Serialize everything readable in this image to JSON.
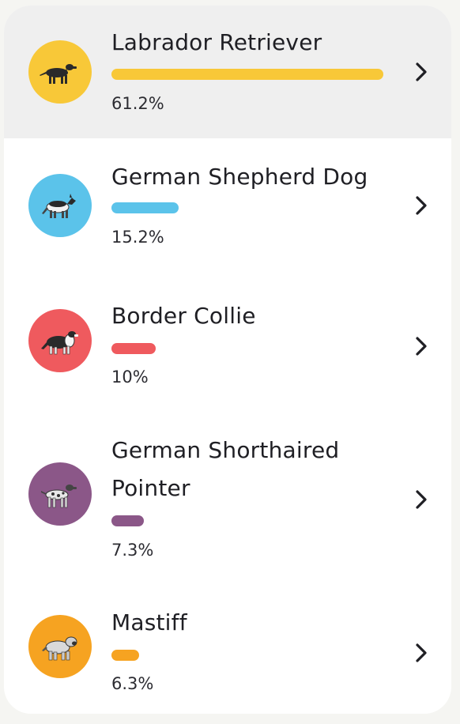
{
  "breeds": [
    {
      "name": "Labrador Retriever",
      "percent_label": "61.2%",
      "share": 61.2,
      "color": "#f8c838",
      "selected": true,
      "icon": "labrador-dog-icon"
    },
    {
      "name": "German Shepherd Dog",
      "percent_label": "15.2%",
      "share": 15.2,
      "color": "#5bc3ea",
      "selected": false,
      "icon": "german-shepherd-dog-icon"
    },
    {
      "name": "Border Collie",
      "percent_label": "10%",
      "share": 10,
      "color": "#ef5a5e",
      "selected": false,
      "icon": "border-collie-dog-icon"
    },
    {
      "name": "German Shorthaired Pointer",
      "percent_label": "7.3%",
      "share": 7.3,
      "color": "#8b5788",
      "selected": false,
      "icon": "pointer-dog-icon"
    },
    {
      "name": "Mastiff",
      "percent_label": "6.3%",
      "share": 6.3,
      "color": "#f6a321",
      "selected": false,
      "icon": "mastiff-dog-icon"
    }
  ]
}
